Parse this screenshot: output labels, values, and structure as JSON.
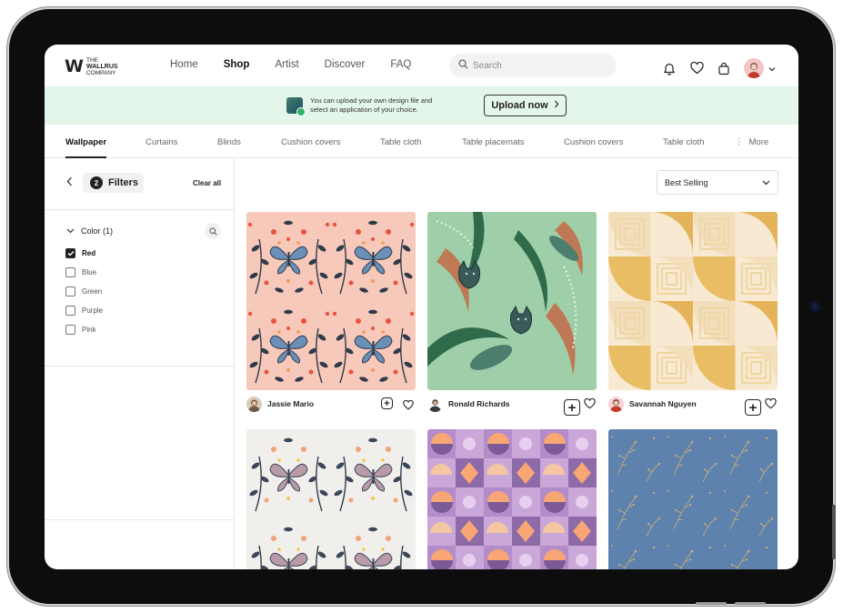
{
  "brand": {
    "mark": "W",
    "line1": "THE",
    "line2": "WALLRUS",
    "line3": "COMPANY"
  },
  "nav": {
    "items": [
      "Home",
      "Shop",
      "Artist",
      "Discover",
      "FAQ"
    ],
    "active": "Shop"
  },
  "search": {
    "placeholder": "Search",
    "value": ""
  },
  "header_icons": [
    "bell-icon",
    "heart-icon",
    "bag-icon",
    "avatar",
    "chevron-down-icon"
  ],
  "banner": {
    "line1": "You can upload your own design file and",
    "line2": "select an application of your choice.",
    "button": "Upload now"
  },
  "tabs": {
    "items": [
      "Wallpaper",
      "Curtains",
      "Blinds",
      "Cushion covers",
      "Table cloth",
      "Table placemats",
      "Cushion covers",
      "Table cloth"
    ],
    "more": "More",
    "active": "Wallpaper"
  },
  "filters": {
    "count": "2",
    "label": "Filters",
    "clear": "Clear all",
    "color_section": "Color (1)",
    "options": [
      {
        "label": "Red",
        "checked": true
      },
      {
        "label": "Blue",
        "checked": false
      },
      {
        "label": "Green",
        "checked": false
      },
      {
        "label": "Purple",
        "checked": false
      },
      {
        "label": "Pink",
        "checked": false
      }
    ]
  },
  "sort": {
    "selected": "Best Selling"
  },
  "products": [
    {
      "artist": "Jassie Mario",
      "pattern": "butterfly-floral-pink"
    },
    {
      "artist": "Ronald Richards",
      "pattern": "jungle-cats-green"
    },
    {
      "artist": "Savannah Nguyen",
      "pattern": "geometric-squares-yellow"
    },
    {
      "artist": "",
      "pattern": "butterfly-floral-white"
    },
    {
      "artist": "",
      "pattern": "geometric-circles-purple"
    },
    {
      "artist": "",
      "pattern": "botanical-sprigs-blue"
    }
  ],
  "colors": {
    "banner_bg": "#e4f5ea",
    "accent_dark": "#222222",
    "border": "#e6e6e6"
  }
}
